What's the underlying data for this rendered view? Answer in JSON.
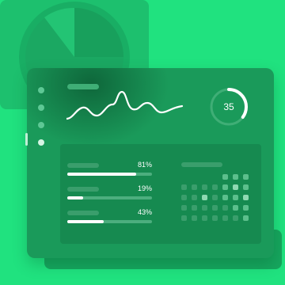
{
  "gauge": {
    "value": "35",
    "fraction": 0.35
  },
  "progress_bars": [
    {
      "percent_label": "81%",
      "value": 0.81
    },
    {
      "percent_label": "19%",
      "value": 0.19
    },
    {
      "percent_label": "43%",
      "value": 0.43
    }
  ],
  "pie": {
    "highlight_fraction": 0.25
  },
  "sidebar": {
    "dot_count": 4,
    "active_index": 3
  },
  "colors": {
    "background": "#20e27f",
    "panel": "#1a9a5a",
    "accent": "#ffffff"
  }
}
